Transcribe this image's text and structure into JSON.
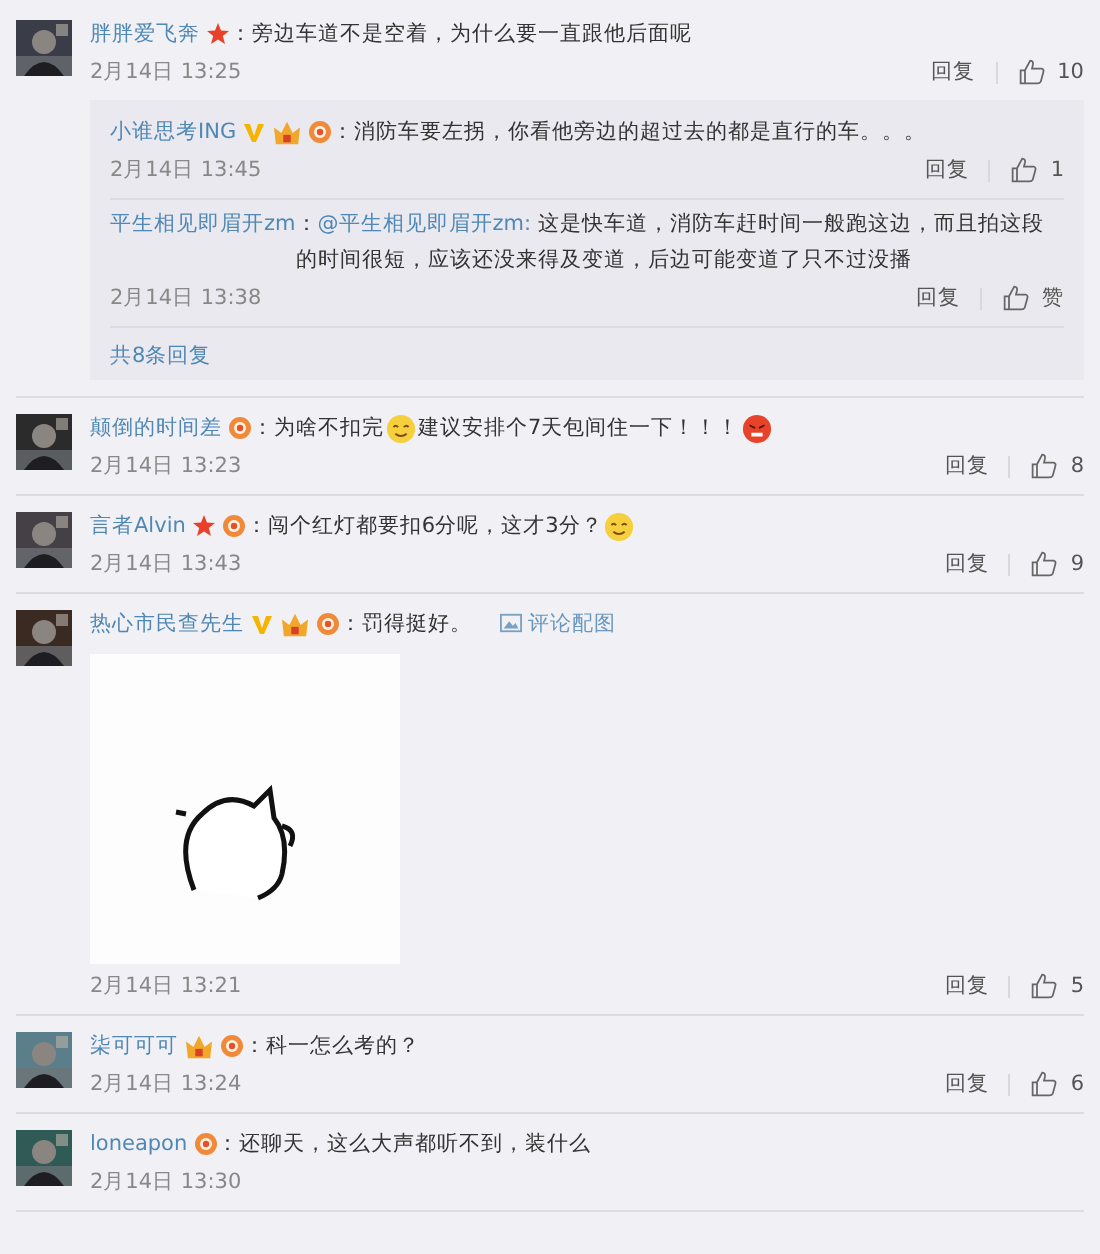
{
  "comments": [
    {
      "avatar": {
        "kind": "picture"
      },
      "user": "胖胖爱飞奔",
      "badges": [
        {
          "kind": "star"
        }
      ],
      "parts": [
        {
          "kind": "text",
          "text": "：旁边车道不是空着，为什么要一直跟他后面呢"
        }
      ],
      "time": "2月14日 13:25",
      "reply": "回复",
      "likes": "10",
      "replies": [
        {
          "user": "小谁思考ING",
          "badges": [
            {
              "kind": "v"
            },
            {
              "kind": "crown"
            },
            {
              "kind": "medal"
            }
          ],
          "parts": [
            {
              "kind": "text",
              "text": "：消防车要左拐，你看他旁边的超过去的都是直行的车。。。"
            }
          ],
          "time": "2月14日 13:45",
          "reply": "回复",
          "likes": "1"
        },
        {
          "user": "平生相见即眉开zm",
          "parts": [
            {
              "kind": "text",
              "text": "："
            },
            {
              "kind": "mention",
              "text": "@平生相见即眉开zm:"
            },
            {
              "kind": "text",
              "text": " 这是快车道，消防车赶时间一般跑这边，而且拍这段的时间很短，应该还没来得及变道，后边可能变道了只不过没播"
            }
          ],
          "time": "2月14日 13:38",
          "reply": "回复",
          "likes": "赞"
        }
      ],
      "more": "共8条回复"
    },
    {
      "avatar": {
        "kind": "picture"
      },
      "user": "颠倒的时间差",
      "badges": [
        {
          "kind": "medal"
        }
      ],
      "parts": [
        {
          "kind": "text",
          "text": "：为啥不扣完"
        },
        {
          "kind": "emoji"
        },
        {
          "kind": "text",
          "text": "建议安排个7天包间住一下！！！"
        },
        {
          "kind": "emoji-angry"
        }
      ],
      "time": "2月14日 13:23",
      "reply": "回复",
      "likes": "8"
    },
    {
      "avatar": {
        "kind": "picture"
      },
      "user": "言者Alvin",
      "badges": [
        {
          "kind": "star"
        },
        {
          "kind": "medal"
        }
      ],
      "parts": [
        {
          "kind": "text",
          "text": "：闯个红灯都要扣6分呢，这才3分？"
        },
        {
          "kind": "emoji"
        }
      ],
      "time": "2月14日 13:43",
      "reply": "回复",
      "likes": "9"
    },
    {
      "avatar": {
        "kind": "picture"
      },
      "user": "热心市民查先生",
      "badges": [
        {
          "kind": "v"
        },
        {
          "kind": "crown"
        },
        {
          "kind": "medal"
        }
      ],
      "parts": [
        {
          "kind": "text",
          "text": "：罚得挺好。"
        }
      ],
      "link": "评论配图",
      "image": {
        "kind": "picture"
      },
      "time": "2月14日 13:21",
      "reply": "回复",
      "likes": "5"
    },
    {
      "avatar": {
        "kind": "picture"
      },
      "user": "柒可可可",
      "badges": [
        {
          "kind": "crown"
        },
        {
          "kind": "medal"
        }
      ],
      "parts": [
        {
          "kind": "text",
          "text": "：科一怎么考的？"
        }
      ],
      "time": "2月14日 13:24",
      "reply": "回复",
      "likes": "6"
    },
    {
      "avatar": {
        "kind": "picture"
      },
      "user": "loneapon",
      "badges": [
        {
          "kind": "medal"
        }
      ],
      "parts": [
        {
          "kind": "text",
          "text": "：还聊天，这么大声都听不到，装什么"
        }
      ],
      "time": "2月14日 13:30"
    }
  ]
}
